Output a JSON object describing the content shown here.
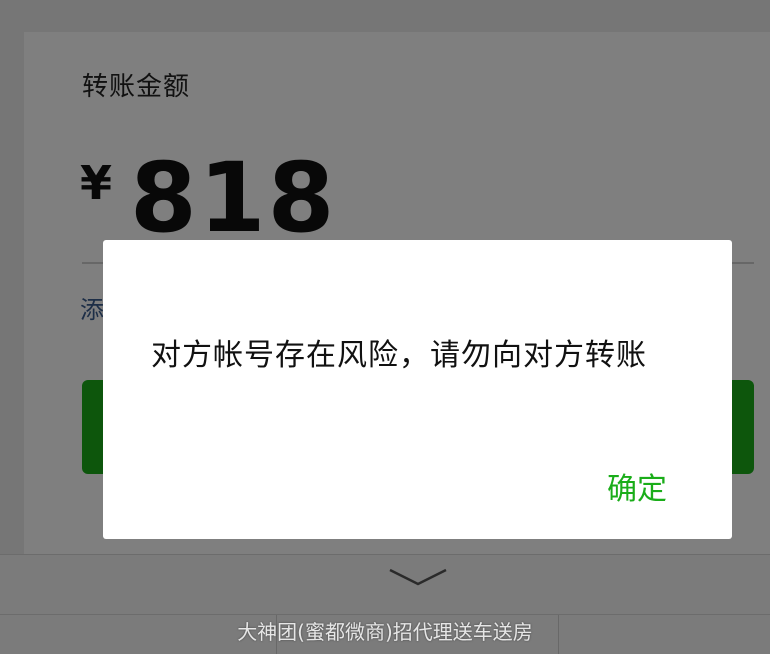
{
  "transfer": {
    "amount_label": "转账金额",
    "currency_symbol": "¥",
    "amount": "818",
    "add_note_label": "添",
    "button_color": "#1aad19"
  },
  "dialog": {
    "message": "对方帐号存在风险，请勿向对方转账",
    "confirm_label": "确定",
    "confirm_color": "#1aad19"
  },
  "bottom": {
    "chevron_icon": "chevron-down-icon"
  },
  "watermark": {
    "text": "大神团(蜜都微商)招代理送车送房"
  }
}
